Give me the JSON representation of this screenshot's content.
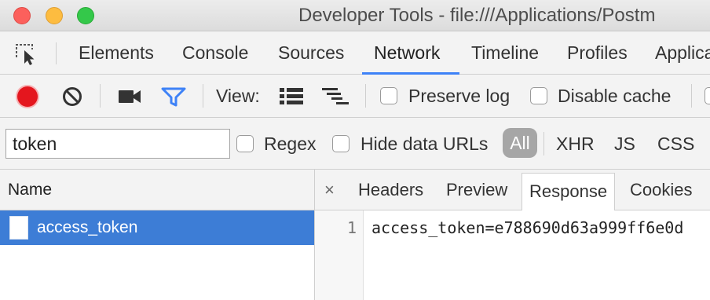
{
  "window": {
    "title": "Developer Tools - file:///Applications/Postm"
  },
  "main_tabs": [
    "Elements",
    "Console",
    "Sources",
    "Network",
    "Timeline",
    "Profiles",
    "Applica"
  ],
  "active_main_tab": "Network",
  "toolbar": {
    "view_label": "View:",
    "preserve_log_label": "Preserve log",
    "disable_cache_label": "Disable cache",
    "preserve_log_checked": false,
    "disable_cache_checked": false
  },
  "filter": {
    "value": "token",
    "regex_label": "Regex",
    "hide_data_urls_label": "Hide data URLs",
    "types": [
      "All",
      "XHR",
      "JS",
      "CSS"
    ],
    "selected_type": "All"
  },
  "requests": {
    "column_header": "Name",
    "items": [
      {
        "name": "access_token",
        "selected": true
      }
    ]
  },
  "detail": {
    "close_symbol": "×",
    "tabs": [
      "Headers",
      "Preview",
      "Response",
      "Cookies"
    ],
    "active_tab": "Response",
    "response_lines": [
      {
        "number": "1",
        "text": "access_token=e788690d63a999ff6e0d"
      }
    ]
  },
  "colors": {
    "record": "#e4161e",
    "accent": "#3e82f7",
    "selected_row": "#3d7dd6",
    "filter_icon": "#3e82f7"
  }
}
